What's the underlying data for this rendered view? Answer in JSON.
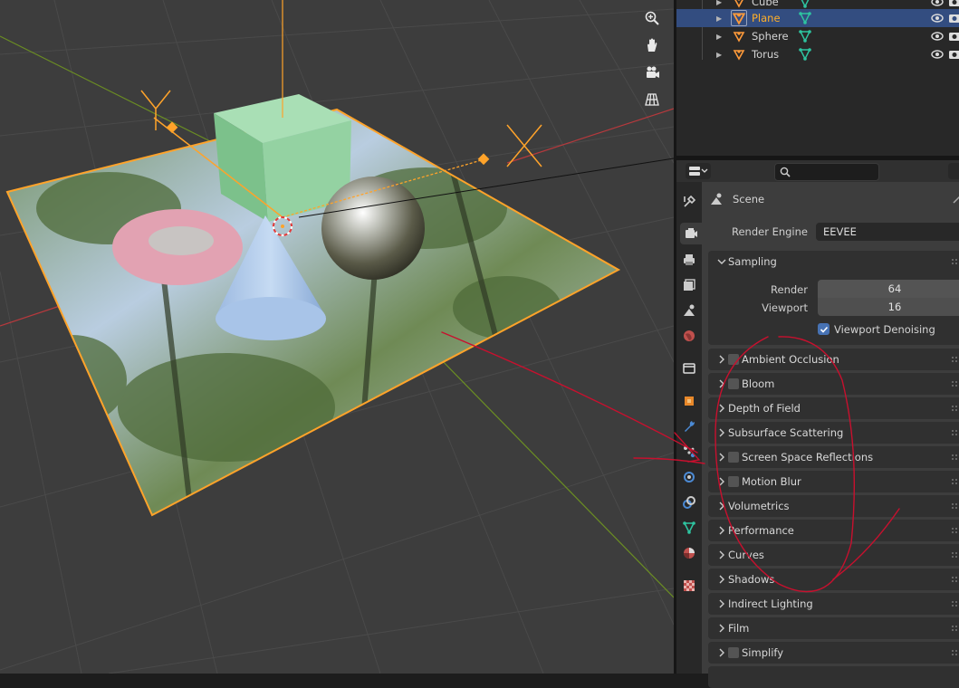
{
  "outliner": {
    "items": [
      {
        "label": "Cube",
        "selected": false
      },
      {
        "label": "Plane",
        "selected": true
      },
      {
        "label": "Sphere",
        "selected": false
      },
      {
        "label": "Torus",
        "selected": false
      }
    ]
  },
  "properties": {
    "search_placeholder": "",
    "context_title": "Scene",
    "render_engine_label": "Render Engine",
    "render_engine_value": "EEVEE",
    "sampling": {
      "title": "Sampling",
      "render_label": "Render",
      "render_value": "64",
      "viewport_label": "Viewport",
      "viewport_value": "16",
      "denoise_label": "Viewport Denoising",
      "denoise_checked": true
    },
    "panels": [
      {
        "title": "Ambient Occlusion",
        "checkbox": true
      },
      {
        "title": "Bloom",
        "checkbox": true
      },
      {
        "title": "Depth of Field",
        "checkbox": false
      },
      {
        "title": "Subsurface Scattering",
        "checkbox": false
      },
      {
        "title": "Screen Space Reflections",
        "checkbox": true
      },
      {
        "title": "Motion Blur",
        "checkbox": true
      },
      {
        "title": "Volumetrics",
        "checkbox": false
      },
      {
        "title": "Performance",
        "checkbox": false
      },
      {
        "title": "Curves",
        "checkbox": false
      },
      {
        "title": "Shadows",
        "checkbox": false
      },
      {
        "title": "Indirect Lighting",
        "checkbox": false
      },
      {
        "title": "Film",
        "checkbox": false
      },
      {
        "title": "Simplify",
        "checkbox": true
      }
    ]
  },
  "tabs": [
    {
      "icon": "tool-icon"
    },
    {
      "icon": "render-icon"
    },
    {
      "icon": "output-icon"
    },
    {
      "icon": "view-layer-icon"
    },
    {
      "icon": "scene-icon"
    },
    {
      "icon": "world-icon"
    },
    {
      "icon": "collection-icon"
    },
    {
      "icon": "object-icon"
    },
    {
      "icon": "modifier-icon"
    },
    {
      "icon": "particles-icon"
    },
    {
      "icon": "physics-icon"
    },
    {
      "icon": "constraints-icon"
    },
    {
      "icon": "data-icon"
    },
    {
      "icon": "material-icon"
    },
    {
      "icon": "texture-icon"
    }
  ],
  "colors": {
    "selection_orange": "#ffa32a",
    "selected_row": "#334d80",
    "annotation_red": "#c8102e",
    "accent_blue": "#4772b3"
  }
}
